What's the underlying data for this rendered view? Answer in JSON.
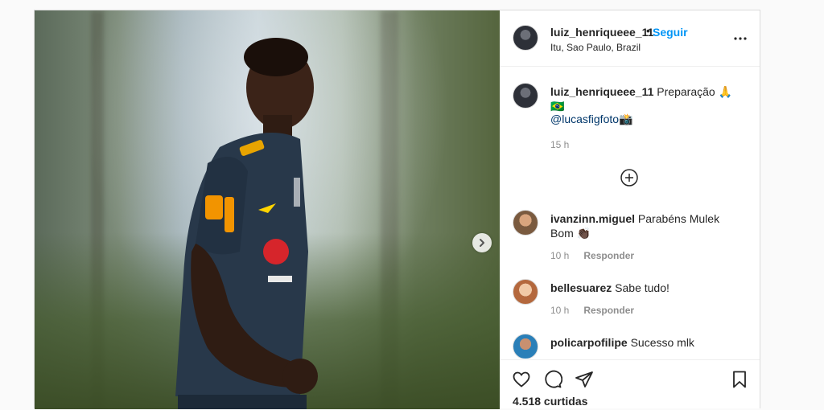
{
  "header": {
    "username": "luiz_henriqueee_11",
    "separator": "•",
    "follow_label": "Seguir",
    "location": "Itu, Sao Paulo, Brazil"
  },
  "caption": {
    "username": "luiz_henriqueee_11",
    "text": "Preparação 🙏🇧🇷",
    "mention": "@lucasfigfoto",
    "mention_suffix": "📸",
    "time": "15 h"
  },
  "comments": [
    {
      "username": "ivanzinn.miguel",
      "text": "Parabéns Mulek Bom 👏🏿",
      "time": "10 h",
      "reply_label": "Responder"
    },
    {
      "username": "bellesuarez",
      "text": "Sabe tudo!",
      "time": "10 h",
      "reply_label": "Responder"
    },
    {
      "username": "policarpofilipe",
      "text": "Sucesso mlk"
    }
  ],
  "likes": "4.518 curtidas",
  "colors": {
    "accent": "#0095f6",
    "text": "#262626",
    "muted": "#8e8e8e",
    "border": "#dbdbdb"
  },
  "icons": [
    "more-options-icon",
    "load-more-comments-icon",
    "like-icon",
    "comment-icon",
    "share-icon",
    "save-icon",
    "next-image-icon"
  ]
}
